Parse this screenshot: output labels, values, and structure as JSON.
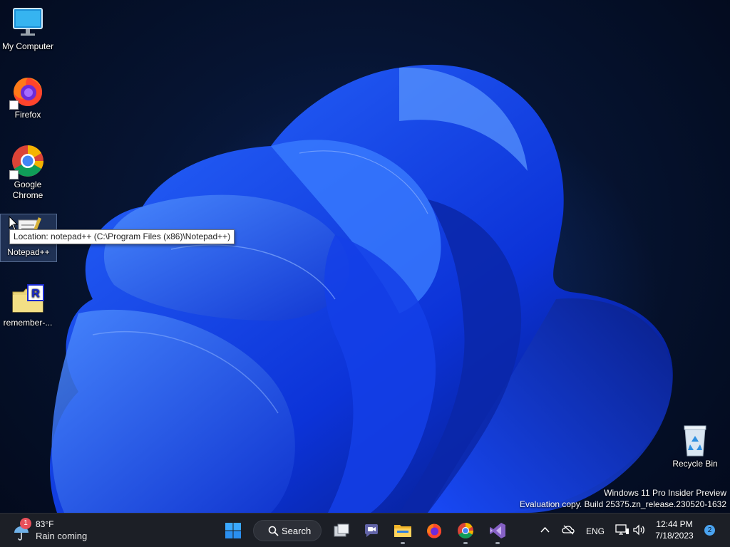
{
  "desktop": {
    "icons": [
      {
        "label": "My Computer",
        "icon": "monitor-icon"
      },
      {
        "label": "Firefox",
        "icon": "firefox-icon"
      },
      {
        "label": "Google Chrome",
        "icon": "chrome-icon"
      },
      {
        "label": "Notepad++",
        "icon": "notepadpp-icon"
      },
      {
        "label": "remember-...",
        "icon": "folder-r-icon"
      },
      {
        "label": "Recycle Bin",
        "icon": "recycle-bin-icon"
      }
    ],
    "tooltip": "Location: notepad++ (C:\\Program Files (x86)\\Notepad++)",
    "watermark": {
      "line1": "Windows 11 Pro Insider Preview",
      "line2": "Evaluation copy. Build 25375.zn_release.230520-1632"
    }
  },
  "taskbar": {
    "weather": {
      "temp": "83°F",
      "condition": "Rain coming",
      "badge": "1"
    },
    "search_label": "Search",
    "apps": [
      "start-icon",
      "task-view-icon",
      "teams-chat-icon",
      "file-explorer-icon",
      "firefox-icon",
      "chrome-icon",
      "visual-studio-icon"
    ],
    "tray": {
      "language": "ENG"
    },
    "clock": {
      "time": "12:44 PM",
      "date": "7/18/2023"
    },
    "notification_count": "2"
  },
  "colors": {
    "accent": "#1a4dff",
    "taskbar": "#1c1f26",
    "notification": "#4aa3f0"
  }
}
